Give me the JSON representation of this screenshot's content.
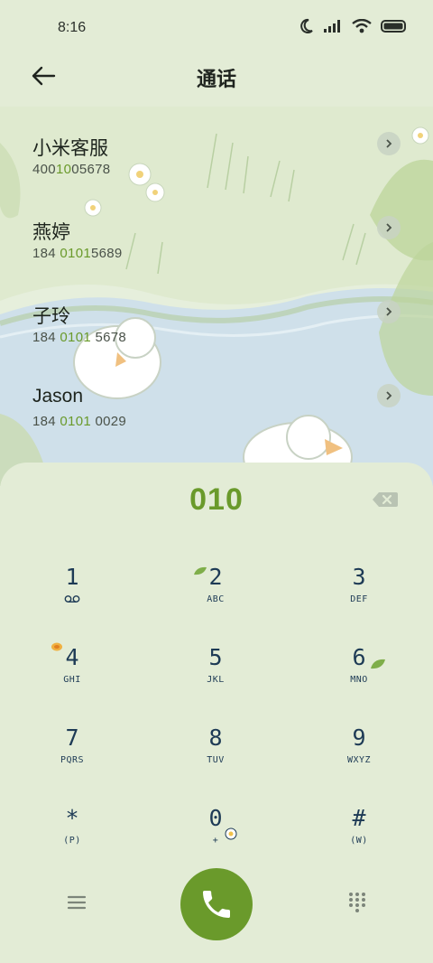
{
  "status": {
    "time": "8:16"
  },
  "header": {
    "title": "通话"
  },
  "contacts": [
    {
      "name": "小米客服",
      "num_pre": "400",
      "num_hl": "10",
      "num_post": "05678"
    },
    {
      "name": "燕婷",
      "num_pre": "184 ",
      "num_hl": "0101",
      "num_post": "5689"
    },
    {
      "name": "子玲",
      "num_pre": "184 ",
      "num_hl": "0101",
      "num_post": " 5678"
    },
    {
      "name": "Jason",
      "num_pre": "184 ",
      "num_hl": "0101",
      "num_post": " 0029"
    }
  ],
  "dialer": {
    "input": "010",
    "keys": [
      {
        "d": "1",
        "l": ""
      },
      {
        "d": "2",
        "l": "ABC"
      },
      {
        "d": "3",
        "l": "DEF"
      },
      {
        "d": "4",
        "l": "GHI"
      },
      {
        "d": "5",
        "l": "JKL"
      },
      {
        "d": "6",
        "l": "MNO"
      },
      {
        "d": "7",
        "l": "PQRS"
      },
      {
        "d": "8",
        "l": "TUV"
      },
      {
        "d": "9",
        "l": "WXYZ"
      },
      {
        "d": "*",
        "l": "(P)"
      },
      {
        "d": "0",
        "l": "+"
      },
      {
        "d": "#",
        "l": "(W)"
      }
    ]
  },
  "colors": {
    "accent": "#6a9a2b",
    "background": "#e3ecd6",
    "key_text": "#1d3a55"
  }
}
